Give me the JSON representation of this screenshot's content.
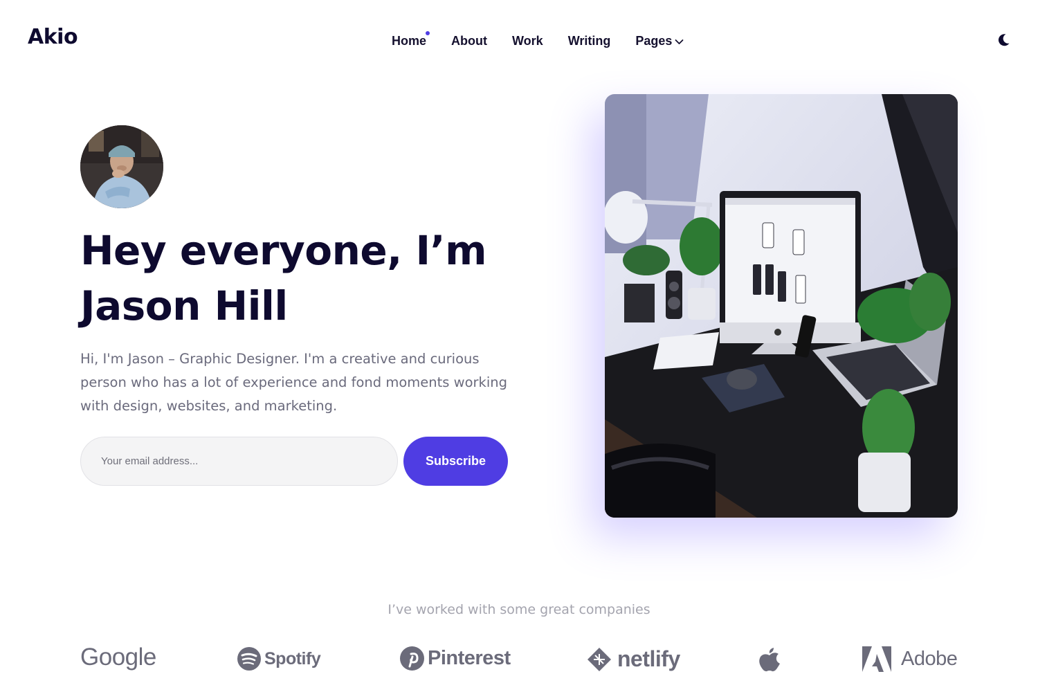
{
  "header": {
    "logo": "Akio",
    "nav": [
      {
        "label": "Home",
        "active": true
      },
      {
        "label": "About"
      },
      {
        "label": "Work"
      },
      {
        "label": "Writing"
      },
      {
        "label": "Pages",
        "has_dropdown": true
      }
    ],
    "theme_toggle_icon": "moon-icon"
  },
  "hero": {
    "title_line1": "Hey everyone, I’m",
    "title_line2": "Jason Hill",
    "description": "Hi, I'm Jason – Graphic Designer. I'm a creative and curious person who has a lot of experience and fond moments working with design, websites, and marketing.",
    "email_placeholder": "Your email address...",
    "email_value": "",
    "subscribe_label": "Subscribe",
    "avatar_icon": "profile-photo",
    "image_icon": "desk-setup-photo"
  },
  "companies": {
    "heading": "I’ve worked with some great companies",
    "logos": [
      {
        "name": "Google",
        "icon": "google-logo"
      },
      {
        "name": "Spotify",
        "icon": "spotify-logo"
      },
      {
        "name": "Pinterest",
        "icon": "pinterest-logo"
      },
      {
        "name": "netlify",
        "icon": "netlify-logo"
      },
      {
        "name": "Apple",
        "icon": "apple-logo"
      },
      {
        "name": "Adobe",
        "icon": "adobe-logo"
      }
    ]
  },
  "colors": {
    "accent": "#4f3de3",
    "text_dark": "#0e0a2f",
    "text_muted": "#6a6a7c",
    "logo_gray": "#6b6b7a"
  }
}
